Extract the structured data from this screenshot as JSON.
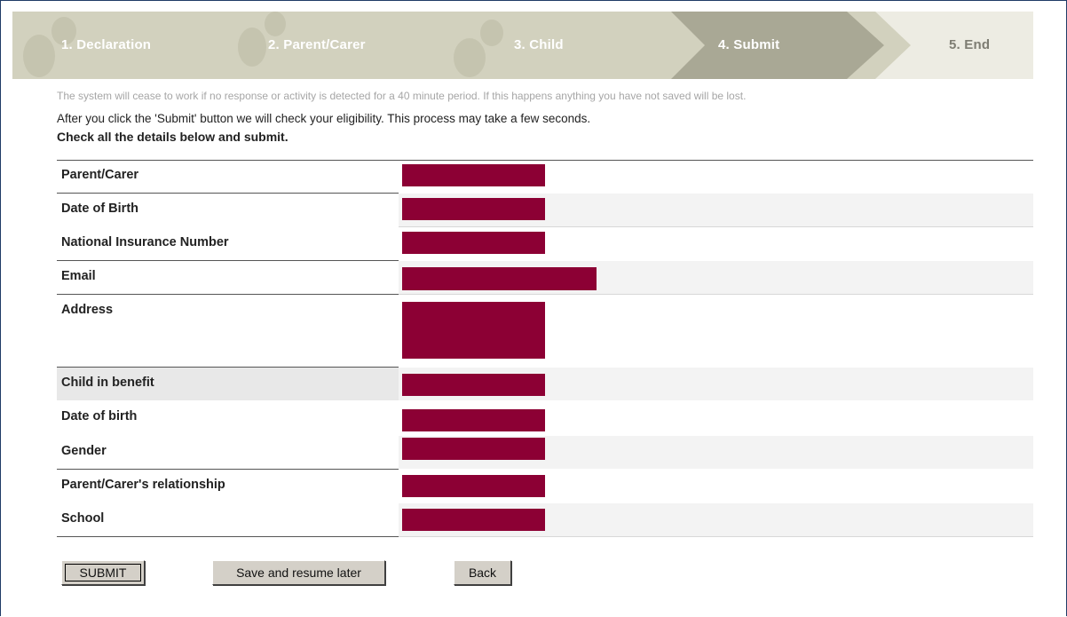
{
  "steps": [
    {
      "label": "1. Declaration"
    },
    {
      "label": "2. Parent/Carer"
    },
    {
      "label": "3. Child"
    },
    {
      "label": "4. Submit"
    },
    {
      "label": "5. End"
    }
  ],
  "notice": "The system will cease to work if no response or activity is detected for a 40 minute period. If this happens anything you have not saved will be lost.",
  "info": "After you click the 'Submit' button we will check your eligibility. This process may take a few seconds.",
  "instruction": "Check all the details below and submit.",
  "rows": [
    {
      "label": "Parent/Carer"
    },
    {
      "label": "Date of Birth"
    },
    {
      "label": "National Insurance Number"
    },
    {
      "label": "Email"
    },
    {
      "label": "Address"
    },
    {
      "label": "Child in benefit"
    },
    {
      "label": "Date of birth"
    },
    {
      "label": "Gender"
    },
    {
      "label": "Parent/Carer's relationship"
    },
    {
      "label": "School"
    }
  ],
  "buttons": {
    "submit": "SUBMIT",
    "save": "Save and resume later",
    "back": "Back"
  },
  "colors": {
    "redaction": "#8c0034",
    "steps_bg": "#d2d1be",
    "active_step": "#a9a895",
    "end_step": "#edece3"
  }
}
